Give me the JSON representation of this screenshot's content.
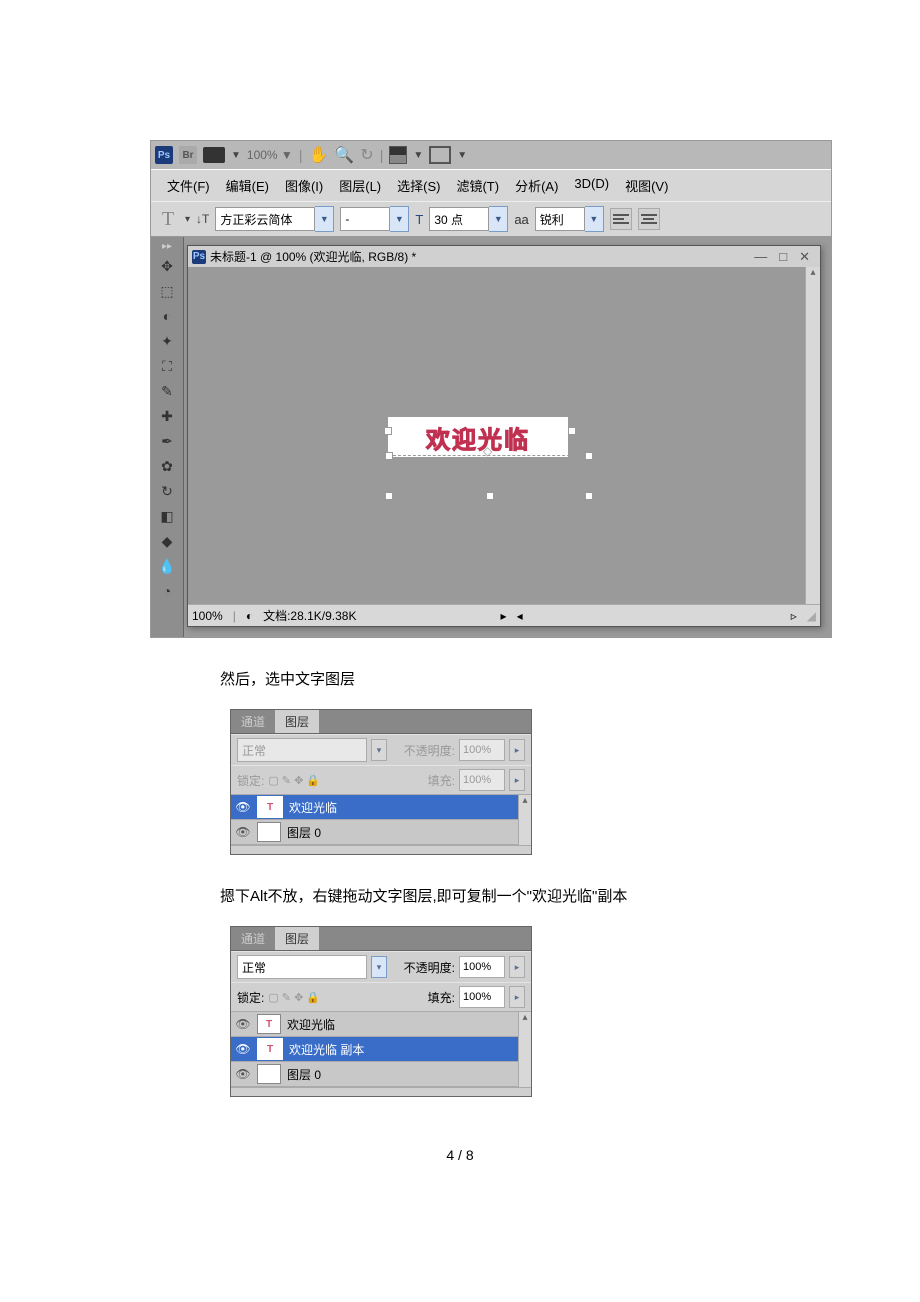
{
  "app_bar": {
    "ps_label": "Ps",
    "br_label": "Br",
    "zoom": "100% ▼"
  },
  "menu": {
    "file": "文件(F)",
    "edit": "编辑(E)",
    "image": "图像(I)",
    "layer": "图层(L)",
    "select": "选择(S)",
    "filter": "滤镜(T)",
    "analysis": "分析(A)",
    "three_d": "3D(D)",
    "view": "视图(V)"
  },
  "options": {
    "font_family": "方正彩云简体",
    "font_style": "-",
    "font_size": "30 点",
    "aa_label": "aa",
    "aa_value": "锐利"
  },
  "doc": {
    "title": "未标题-1 @ 100% (欢迎光临, RGB/8) *",
    "welcome_text": "欢迎光临",
    "status_zoom": "100%",
    "status_doc": "文档:28.1K/9.38K"
  },
  "body_text_1": "然后，选中文字图层",
  "panel1": {
    "tab_channel": "通道",
    "tab_layer": "图层",
    "blend_mode": "正常",
    "opacity_label": "不透明度:",
    "opacity_value": "100%",
    "lock_label": "锁定:",
    "fill_label": "填充:",
    "fill_value": "100%",
    "layers": [
      {
        "name": "欢迎光临",
        "type": "T",
        "selected": true
      },
      {
        "name": "图层 0",
        "type": "",
        "selected": false
      }
    ]
  },
  "body_text_2": "摁下Alt不放，右键拖动文字图层,即可复制一个\"欢迎光临\"副本",
  "panel2": {
    "tab_channel": "通道",
    "tab_layer": "图层",
    "blend_mode": "正常",
    "opacity_label": "不透明度:",
    "opacity_value": "100%",
    "lock_label": "锁定:",
    "fill_label": "填充:",
    "fill_value": "100%",
    "layers": [
      {
        "name": "欢迎光临",
        "type": "T",
        "selected": false
      },
      {
        "name": "欢迎光临 副本",
        "type": "T",
        "selected": true
      },
      {
        "name": "图层 0",
        "type": "",
        "selected": false
      }
    ]
  },
  "page_num": "4 / 8"
}
